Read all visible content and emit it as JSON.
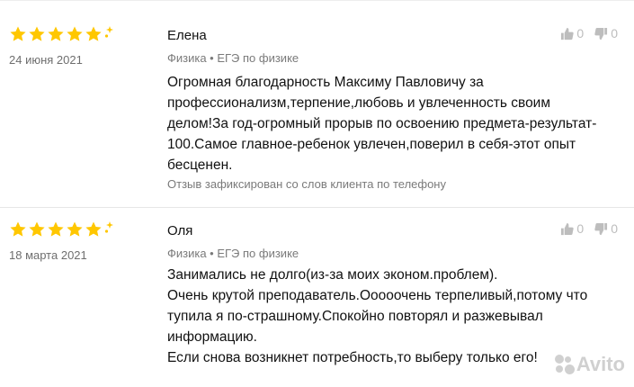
{
  "reviews": [
    {
      "author": "Елена",
      "date": "24 июня 2021",
      "rating": 5,
      "meta": "Физика • ЕГЭ по физике",
      "lines": [
        "Огромная благодарность Максиму Павловичу за",
        "профессионализм,терпение,любовь и увлеченность своим",
        "делом!За год-огромный прорыв по освоению предмета-результат-",
        "100.Самое главное-ребенок увлечен,поверил в себя-этот опыт",
        "бесценен."
      ],
      "footnote": "Отзыв зафиксирован со слов клиента по телефону",
      "likes": "0",
      "dislikes": "0"
    },
    {
      "author": "Оля",
      "date": "18 марта 2021",
      "rating": 5,
      "meta": "Физика • ЕГЭ по физике",
      "lines": [
        "Занимались не долго(из-за моих эконом.проблем).",
        "Очень крутой преподаватель.Ооооочень терпеливый,потому что",
        "тупила я по-страшному.Спокойно повторял и разжевывал",
        "информацию.",
        "Если снова возникнет потребность,то выберу только его!"
      ],
      "likes": "0",
      "dislikes": "0"
    }
  ],
  "watermark": "Avito",
  "colors": {
    "star": "#ffc700",
    "vote_icon": "#bdbdbd"
  }
}
